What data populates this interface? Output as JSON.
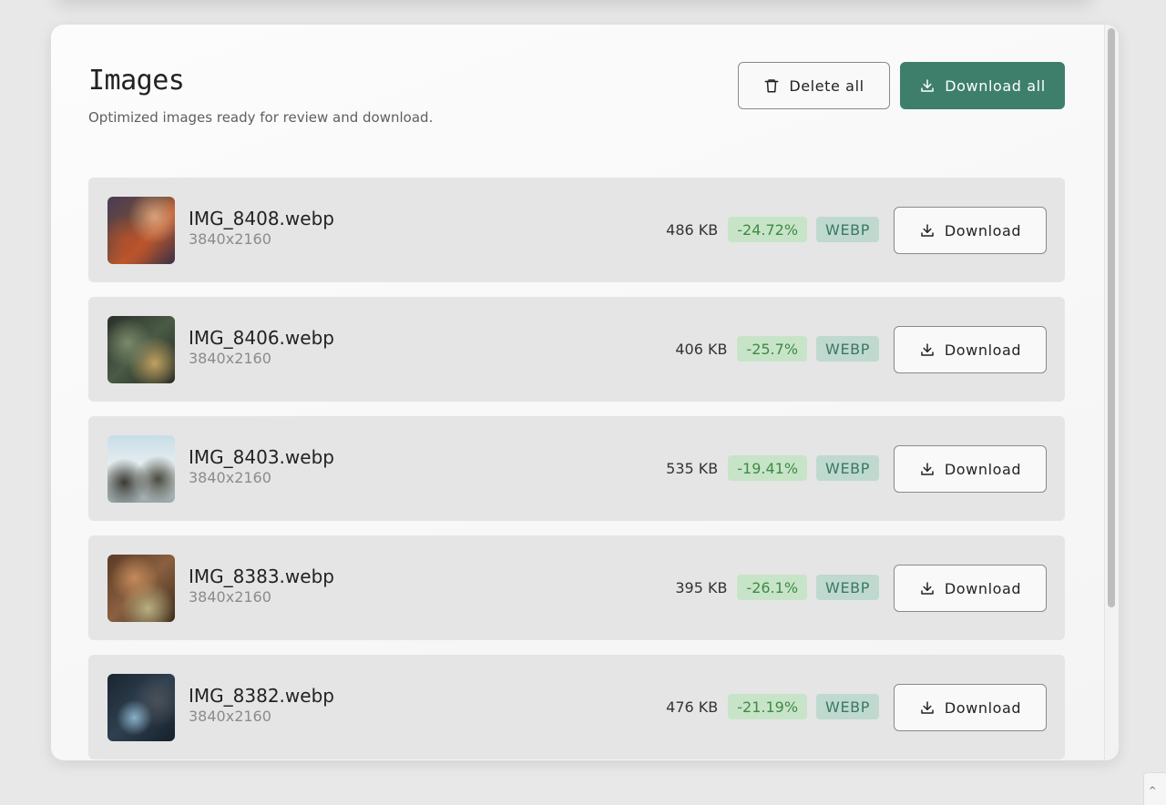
{
  "header": {
    "title": "Images",
    "subtitle": "Optimized images ready for review and download.",
    "delete_all_label": "Delete all",
    "download_all_label": "Download all"
  },
  "colors": {
    "primary": "#3e7f6c",
    "percent_badge_bg": "#c8e4c8",
    "percent_badge_text": "#3e8a44",
    "format_badge_bg": "#bfd9cf",
    "format_badge_text": "#3a7766"
  },
  "icons": {
    "delete_all": "trash-icon",
    "download": "download-icon"
  },
  "images": [
    {
      "name": "IMG_8408.webp",
      "dimensions": "3840x2160",
      "size": "486 KB",
      "reduction": "-24.72%",
      "format": "WEBP",
      "download_label": "Download"
    },
    {
      "name": "IMG_8406.webp",
      "dimensions": "3840x2160",
      "size": "406 KB",
      "reduction": "-25.7%",
      "format": "WEBP",
      "download_label": "Download"
    },
    {
      "name": "IMG_8403.webp",
      "dimensions": "3840x2160",
      "size": "535 KB",
      "reduction": "-19.41%",
      "format": "WEBP",
      "download_label": "Download"
    },
    {
      "name": "IMG_8383.webp",
      "dimensions": "3840x2160",
      "size": "395 KB",
      "reduction": "-26.1%",
      "format": "WEBP",
      "download_label": "Download"
    },
    {
      "name": "IMG_8382.webp",
      "dimensions": "3840x2160",
      "size": "476 KB",
      "reduction": "-21.19%",
      "format": "WEBP",
      "download_label": "Download"
    }
  ]
}
